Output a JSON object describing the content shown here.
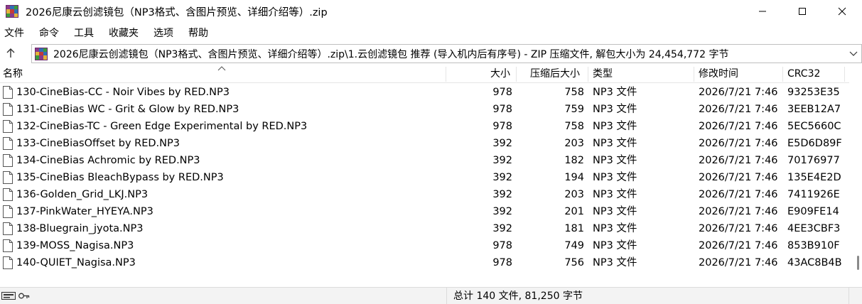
{
  "window": {
    "title": "2026尼康云创滤镜包（NP3格式、含图片预览、详细介绍等）.zip"
  },
  "menu": [
    "文件",
    "命令",
    "工具",
    "收藏夹",
    "选项",
    "帮助"
  ],
  "address": {
    "path": "2026尼康云创滤镜包（NP3格式、含图片预览、详细介绍等）.zip\\1.云创滤镜包 推荐 (导入机内后有序号)  - ZIP 压缩文件, 解包大小为 24,454,772 字节"
  },
  "columns": {
    "name": "名称",
    "size": "大小",
    "packed": "压缩后大小",
    "type": "类型",
    "mtime": "修改时间",
    "crc": "CRC32"
  },
  "files": [
    {
      "name": "130-CineBias-CC - Noir Vibes by RED.NP3",
      "size": "978",
      "packed": "758",
      "type": "NP3 文件",
      "mtime": "2026/7/21 7:46",
      "crc": "93253E35"
    },
    {
      "name": "131-CineBias WC - Grit & Glow by RED.NP3",
      "size": "978",
      "packed": "759",
      "type": "NP3 文件",
      "mtime": "2026/7/21 7:46",
      "crc": "3EEB12A7"
    },
    {
      "name": "132-CineBias-TC - Green Edge Experimental by RED.NP3",
      "size": "978",
      "packed": "758",
      "type": "NP3 文件",
      "mtime": "2026/7/21 7:46",
      "crc": "5EC5660C"
    },
    {
      "name": "133-CineBiasOffset by RED.NP3",
      "size": "392",
      "packed": "203",
      "type": "NP3 文件",
      "mtime": "2026/7/21 7:46",
      "crc": "E5D6D89F"
    },
    {
      "name": "134-CineBias Achromic by RED.NP3",
      "size": "392",
      "packed": "182",
      "type": "NP3 文件",
      "mtime": "2026/7/21 7:46",
      "crc": "70176977"
    },
    {
      "name": "135-CineBias BleachBypass by RED.NP3",
      "size": "392",
      "packed": "194",
      "type": "NP3 文件",
      "mtime": "2026/7/21 7:46",
      "crc": "135E4E2D"
    },
    {
      "name": "136-Golden_Grid_LKJ.NP3",
      "size": "392",
      "packed": "203",
      "type": "NP3 文件",
      "mtime": "2026/7/21 7:46",
      "crc": "7411926E"
    },
    {
      "name": "137-PinkWater_HYEYA.NP3",
      "size": "392",
      "packed": "201",
      "type": "NP3 文件",
      "mtime": "2026/7/21 7:46",
      "crc": "E909FE14"
    },
    {
      "name": "138-Bluegrain_jyota.NP3",
      "size": "392",
      "packed": "181",
      "type": "NP3 文件",
      "mtime": "2026/7/21 7:46",
      "crc": "4EE3CBF3"
    },
    {
      "name": "139-MOSS_Nagisa.NP3",
      "size": "978",
      "packed": "749",
      "type": "NP3 文件",
      "mtime": "2026/7/21 7:46",
      "crc": "853B910F"
    },
    {
      "name": "140-QUIET_Nagisa.NP3",
      "size": "978",
      "packed": "756",
      "type": "NP3 文件",
      "mtime": "2026/7/21 7:46",
      "crc": "43AC8B4B"
    }
  ],
  "status": {
    "summary": "总计 140 文件, 81,250 字节"
  },
  "icons": {
    "app": "winrar-books-icon",
    "up": "up-arrow-icon",
    "file": "file-icon",
    "status": [
      "disk-icon",
      "key-icon"
    ]
  },
  "colors": {
    "separator": "#e5e5e5",
    "status_bg": "#f3f3f3",
    "border": "#bfbfbf"
  }
}
